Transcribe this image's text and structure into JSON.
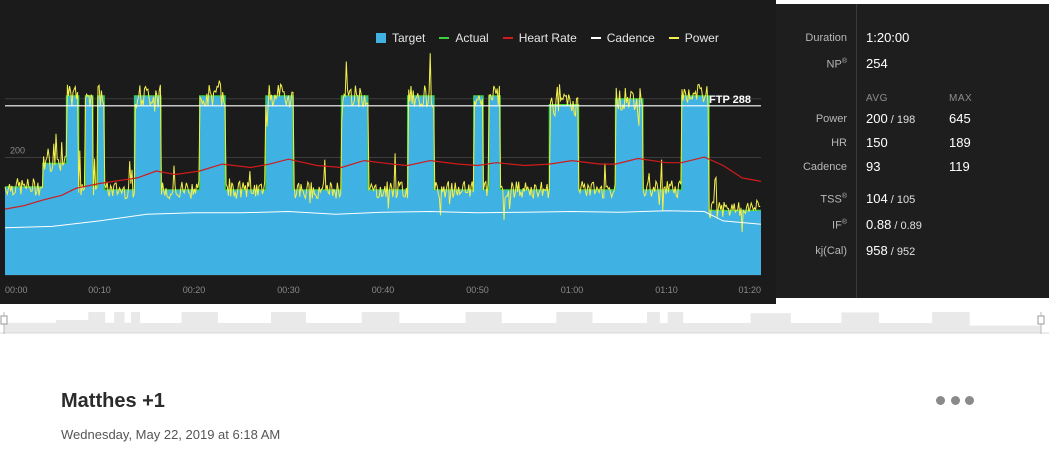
{
  "legend": [
    {
      "label": "Target",
      "color": "#3fb1e3",
      "kind": "box"
    },
    {
      "label": "Actual",
      "color": "#3ccf3c",
      "kind": "line"
    },
    {
      "label": "Heart Rate",
      "color": "#d11b1b",
      "kind": "line"
    },
    {
      "label": "Cadence",
      "color": "#ffffff",
      "kind": "line"
    },
    {
      "label": "Power",
      "color": "#f2f04a",
      "kind": "line"
    }
  ],
  "chart": {
    "ftp_label": "FTP 288",
    "y_tick_label": "200",
    "x_ticks": [
      "00:00",
      "00:10",
      "00:20",
      "00:30",
      "00:40",
      "00:50",
      "01:00",
      "01:10",
      "01:20"
    ]
  },
  "chart_data": {
    "type": "area",
    "xlabel": "",
    "ylabel": "",
    "x_unit": "minutes",
    "xlim": [
      0,
      80
    ],
    "ylim": [
      0,
      400
    ],
    "ftp": 288,
    "target_intervals": [
      {
        "start": 0,
        "end": 4,
        "watts": 150
      },
      {
        "start": 4,
        "end": 6.5,
        "watts": 190
      },
      {
        "start": 6.5,
        "end": 7.8,
        "watts": 305
      },
      {
        "start": 7.8,
        "end": 8.5,
        "watts": 150
      },
      {
        "start": 8.5,
        "end": 9.3,
        "watts": 305
      },
      {
        "start": 9.3,
        "end": 9.8,
        "watts": 150
      },
      {
        "start": 9.8,
        "end": 10.5,
        "watts": 305
      },
      {
        "start": 10.5,
        "end": 13.7,
        "watts": 145
      },
      {
        "start": 13.7,
        "end": 16.5,
        "watts": 305
      },
      {
        "start": 16.5,
        "end": 20.6,
        "watts": 145
      },
      {
        "start": 20.6,
        "end": 23.3,
        "watts": 305
      },
      {
        "start": 23.3,
        "end": 27.6,
        "watts": 145
      },
      {
        "start": 27.6,
        "end": 30.5,
        "watts": 305
      },
      {
        "start": 30.5,
        "end": 35.6,
        "watts": 145
      },
      {
        "start": 35.6,
        "end": 38.4,
        "watts": 305
      },
      {
        "start": 38.4,
        "end": 42.6,
        "watts": 145
      },
      {
        "start": 42.6,
        "end": 45.4,
        "watts": 305
      },
      {
        "start": 45.4,
        "end": 49.6,
        "watts": 145
      },
      {
        "start": 49.6,
        "end": 50.6,
        "watts": 305
      },
      {
        "start": 50.6,
        "end": 51.2,
        "watts": 145
      },
      {
        "start": 51.2,
        "end": 52.4,
        "watts": 305
      },
      {
        "start": 52.4,
        "end": 57.6,
        "watts": 145
      },
      {
        "start": 57.6,
        "end": 60.7,
        "watts": 290
      },
      {
        "start": 60.7,
        "end": 64.6,
        "watts": 145
      },
      {
        "start": 64.6,
        "end": 67.5,
        "watts": 300
      },
      {
        "start": 67.5,
        "end": 71.6,
        "watts": 145
      },
      {
        "start": 71.6,
        "end": 74.5,
        "watts": 305
      },
      {
        "start": 74.5,
        "end": 80,
        "watts": 110
      }
    ],
    "heart_rate_bpm": [
      [
        0,
        95
      ],
      [
        2,
        100
      ],
      [
        4,
        108
      ],
      [
        6,
        115
      ],
      [
        7.5,
        125
      ],
      [
        10,
        132
      ],
      [
        14,
        140
      ],
      [
        16,
        150
      ],
      [
        18,
        145
      ],
      [
        20.6,
        150
      ],
      [
        23,
        160
      ],
      [
        26,
        155
      ],
      [
        28,
        160
      ],
      [
        30,
        167
      ],
      [
        33,
        158
      ],
      [
        35.6,
        155
      ],
      [
        38,
        165
      ],
      [
        41,
        160
      ],
      [
        42.6,
        158
      ],
      [
        45,
        165
      ],
      [
        48,
        160
      ],
      [
        50,
        158
      ],
      [
        52,
        162
      ],
      [
        55,
        158
      ],
      [
        57.6,
        160
      ],
      [
        60,
        165
      ],
      [
        63,
        160
      ],
      [
        64.6,
        160
      ],
      [
        67,
        168
      ],
      [
        70,
        162
      ],
      [
        71.6,
        162
      ],
      [
        74,
        170
      ],
      [
        76,
        158
      ],
      [
        78,
        140
      ],
      [
        80,
        135
      ]
    ],
    "cadence_rpm": [
      [
        0,
        70
      ],
      [
        5,
        72
      ],
      [
        10,
        80
      ],
      [
        15,
        90
      ],
      [
        20,
        92
      ],
      [
        25,
        92
      ],
      [
        30,
        94
      ],
      [
        35,
        90
      ],
      [
        40,
        93
      ],
      [
        45,
        94
      ],
      [
        50,
        92
      ],
      [
        55,
        93
      ],
      [
        60,
        94
      ],
      [
        65,
        93
      ],
      [
        70,
        95
      ],
      [
        74,
        94
      ],
      [
        76,
        80
      ],
      [
        80,
        75
      ]
    ]
  },
  "stats": {
    "duration_label": "Duration",
    "duration_value": "1:20:00",
    "np_label": "NP",
    "np_sup": "®",
    "np_value": "254",
    "avg_header": "AVG",
    "max_header": "MAX",
    "power_label": "Power",
    "power_avg": "200",
    "power_avg_sub": "198",
    "power_max": "645",
    "hr_label": "HR",
    "hr_avg": "150",
    "hr_max": "189",
    "cadence_label": "Cadence",
    "cadence_avg": "93",
    "cadence_max": "119",
    "tss_label": "TSS",
    "tss_sup": "®",
    "tss_value": "104",
    "tss_sub": "105",
    "if_label": "IF",
    "if_sup": "®",
    "if_value": "0.88",
    "if_sub": "0.89",
    "kj_label": "kj(Cal)",
    "kj_value": "958",
    "kj_sub": "952",
    "sep": " / "
  },
  "activity": {
    "title": "Matthes +1",
    "date": "Wednesday, May 22, 2019 at 6:18 AM"
  },
  "colors": {
    "panel_bg": "#1b1b1b",
    "target": "#3fb1e3",
    "actual": "#3ccf3c",
    "heart_rate": "#d11b1b",
    "cadence": "#ffffff",
    "power": "#f2f04a"
  }
}
